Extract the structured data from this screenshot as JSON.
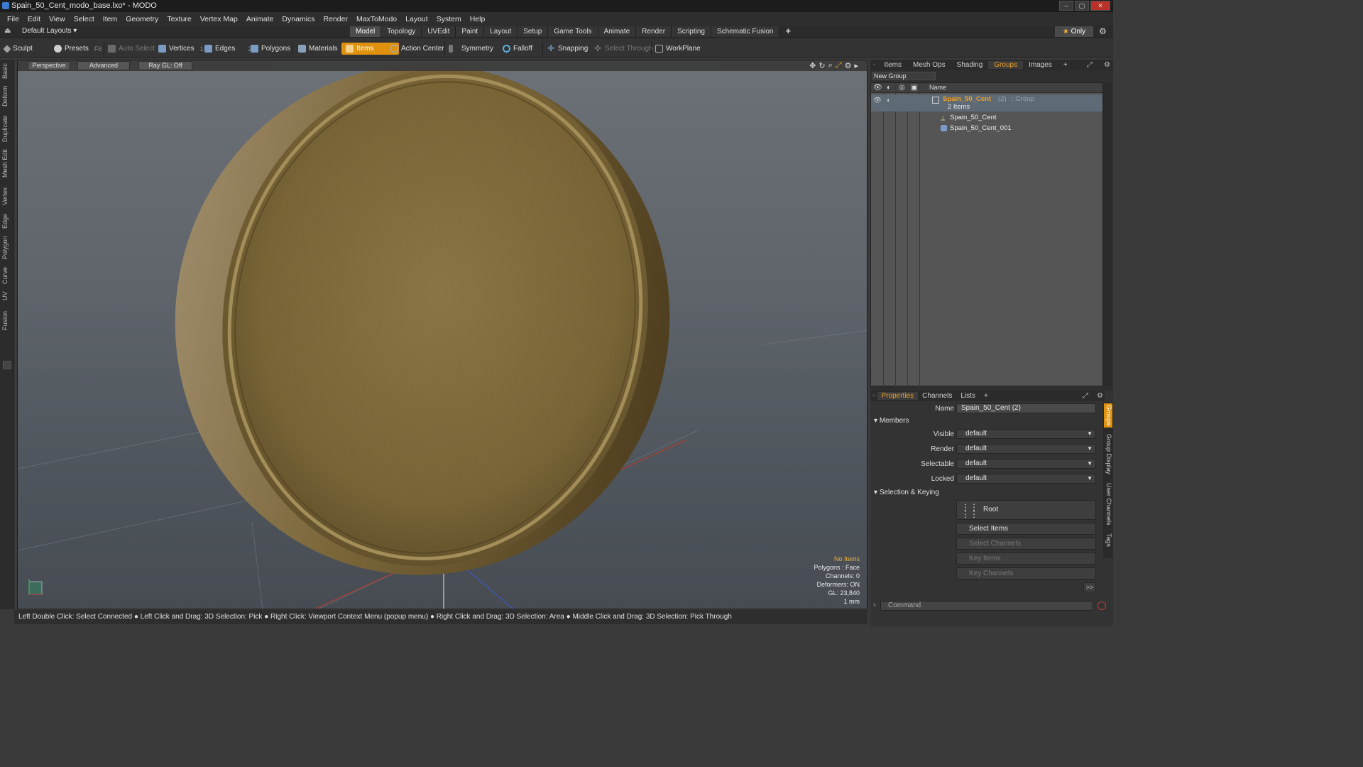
{
  "window": {
    "title": "Spain_50_Cent_modo_base.lxo* - MODO"
  },
  "menu": [
    "File",
    "Edit",
    "View",
    "Select",
    "Item",
    "Geometry",
    "Texture",
    "Vertex Map",
    "Animate",
    "Dynamics",
    "Render",
    "MaxToModo",
    "Layout",
    "System",
    "Help"
  ],
  "layout_bar": {
    "default_layouts": "Default Layouts ▾",
    "tabs": [
      "Model",
      "Topology",
      "UVEdit",
      "Paint",
      "Layout",
      "Setup",
      "Game Tools",
      "Animate",
      "Render",
      "Scripting",
      "Schematic Fusion"
    ],
    "active_tab": "Model",
    "plus": "+",
    "only": "Only"
  },
  "toolbar": {
    "sculpt": "Sculpt",
    "presets": "Presets",
    "presets_hotkey": "F6",
    "auto_select": "Auto Select",
    "vertices": "Vertices",
    "vertices_hotkey": "1",
    "edges": "Edges",
    "edges_hotkey": "2",
    "polygons": "Polygons",
    "materials": "Materials",
    "items": "Items",
    "action_center": "Action Center",
    "symmetry": "Symmetry",
    "falloff": "Falloff",
    "snapping": "Snapping",
    "select_through": "Select Through",
    "workplane": "WorkPlane"
  },
  "left_tabs": [
    "Basic",
    "Deform",
    "Duplicate",
    "Mesh Edit",
    "Vertex",
    "Edge",
    "Polygon",
    "Curve",
    "UV",
    "Fusion"
  ],
  "viewport": {
    "view": "Perspective",
    "advanced": "Advanced",
    "raygl": "Ray GL: Off",
    "info": {
      "no_items": "No Items",
      "polygons": "Polygons : Face",
      "channels": "Channels: 0",
      "deformers": "Deformers: ON",
      "gl": "GL: 23,840",
      "unit": "1 mm"
    },
    "colors": {
      "coin": "#8a7440",
      "coin_dark": "#5e4d28",
      "axis_x": "#c0392b",
      "axis_z": "#3a5ad0"
    }
  },
  "status_bar": "Left Double Click: Select Connected ● Left Click and Drag: 3D Selection: Pick ● Right Click: Viewport Context Menu (popup menu) ● Right Click and Drag: 3D Selection: Area ● Middle Click and Drag: 3D Selection: Pick Through",
  "right_panel": {
    "tabs": [
      "Items",
      "Mesh Ops",
      "Shading",
      "Groups",
      "Images",
      "+"
    ],
    "active_tab": "Groups",
    "new_group": "New Group",
    "list_header": "Name",
    "group": {
      "name": "Spain_50_Cent",
      "count": "(2)",
      "type": ": Group",
      "items_text": "2 Items"
    },
    "children": [
      "Spain_50_Cent",
      "Spain_50_Cent_001"
    ]
  },
  "properties": {
    "tabs": [
      "Properties",
      "Channels",
      "Lists",
      "+"
    ],
    "active_tab": "Properties",
    "name_label": "Name",
    "name_value": "Spain_50_Cent (2)",
    "members": "Members",
    "visible_label": "Visible",
    "visible_value": "default",
    "render_label": "Render",
    "render_value": "default",
    "selectable_label": "Selectable",
    "selectable_value": "default",
    "locked_label": "Locked",
    "locked_value": "default",
    "sel_keying": "Selection & Keying",
    "root": "Root",
    "select_items": "Select Items",
    "select_channels": "Select Channels",
    "key_items": "Key Items",
    "key_channels": "Key Channels",
    "more": ">>",
    "side_tabs": [
      "Groups",
      "Group Display",
      "User Channels",
      "Tags"
    ]
  },
  "command": {
    "placeholder": "Command"
  }
}
